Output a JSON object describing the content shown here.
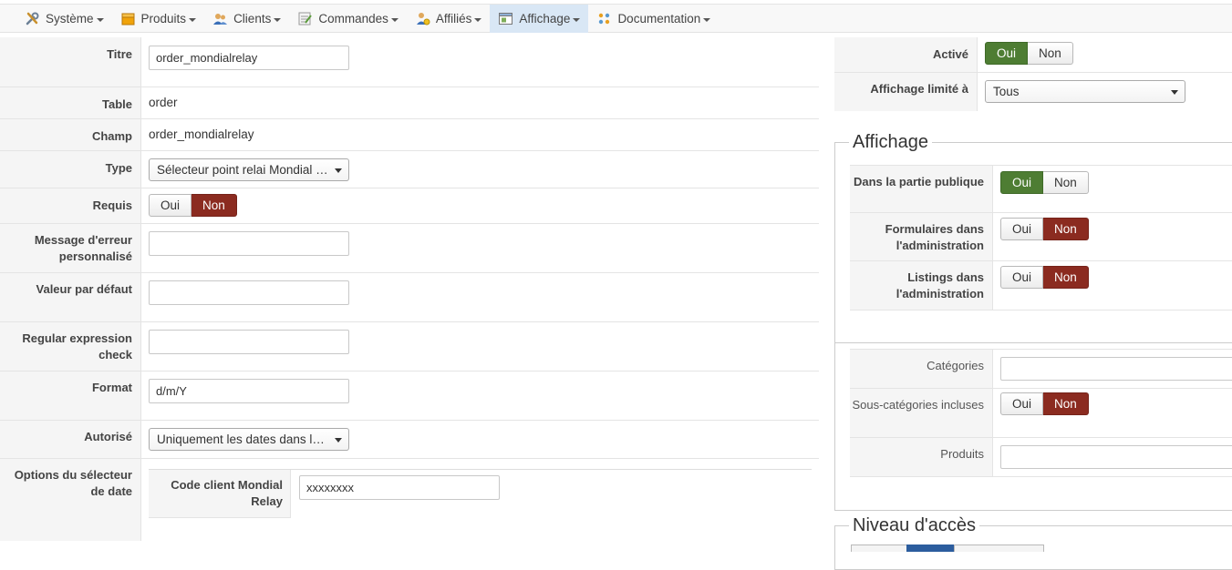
{
  "menu": {
    "items": [
      {
        "label": "Système",
        "icon": "tools-icon"
      },
      {
        "label": "Produits",
        "icon": "box-icon"
      },
      {
        "label": "Clients",
        "icon": "users-icon"
      },
      {
        "label": "Commandes",
        "icon": "order-icon"
      },
      {
        "label": "Affiliés",
        "icon": "affiliates-icon"
      },
      {
        "label": "Affichage",
        "icon": "display-icon"
      },
      {
        "label": "Documentation",
        "icon": "help-icon"
      }
    ],
    "active_color": "#d9e7f5"
  },
  "form": {
    "titre": {
      "label": "Titre",
      "value": "order_mondialrelay"
    },
    "table": {
      "label": "Table",
      "value": "order"
    },
    "champ": {
      "label": "Champ",
      "value": "order_mondialrelay"
    },
    "type": {
      "label": "Type",
      "value": "Sélecteur point relai Mondial …"
    },
    "requis": {
      "label": "Requis",
      "yes": "Oui",
      "no": "Non",
      "selected": "Non"
    },
    "message": {
      "label": "Message d'erreur personnalisé",
      "value": ""
    },
    "defaut": {
      "label": "Valeur par défaut",
      "value": ""
    },
    "regex": {
      "label": "Regular expression check",
      "value": ""
    },
    "format": {
      "label": "Format",
      "value": "d/m/Y"
    },
    "autorise": {
      "label": "Autorisé",
      "value": "Uniquement les dates dans l…"
    },
    "options": {
      "label": "Options du sélecteur de date",
      "code_label": "Code client Mondial Relay",
      "code_value": "xxxxxxxx"
    }
  },
  "right": {
    "active": {
      "label": "Activé",
      "yes": "Oui",
      "no": "Non",
      "selected": "Oui"
    },
    "limite": {
      "label": "Affichage limité à",
      "value": "Tous"
    },
    "affichage": {
      "legend": "Affichage",
      "publique": {
        "label": "Dans la partie publique",
        "yes": "Oui",
        "no": "Non",
        "selected": "Oui"
      },
      "formulaires": {
        "label": "Formulaires dans l'administration",
        "yes": "Oui",
        "no": "Non",
        "selected": "Non"
      },
      "listings": {
        "label": "Listings dans l'administration",
        "yes": "Oui",
        "no": "Non",
        "selected": "Non"
      }
    },
    "categories": {
      "label": "Catégories",
      "value": ""
    },
    "sous_categories": {
      "label": "Sous-catégories incluses",
      "yes": "Oui",
      "no": "Non",
      "selected": "Non"
    },
    "produits": {
      "label": "Produits",
      "value": ""
    },
    "niveau": {
      "legend": "Niveau d'accès"
    }
  },
  "colors": {
    "green": "#4e7d33",
    "red": "#8b2b20"
  }
}
